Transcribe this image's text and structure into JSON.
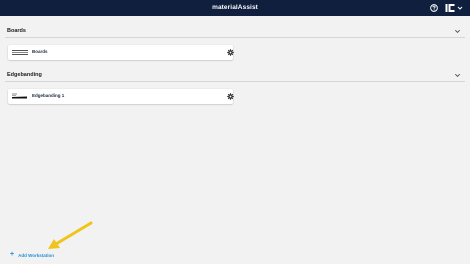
{
  "app": {
    "title": "materialAssist"
  },
  "colors": {
    "topbar": "#0f1f3d",
    "accent": "#1e8fd6",
    "background": "#f2f2f2",
    "annotation_arrow": "#f0c419"
  },
  "icons": {
    "help": "help-icon",
    "brand": "ihb-logo-icon",
    "account_menu": "chevron-down-icon",
    "collapse": "chevron-up-icon",
    "settings": "gear-icon",
    "add": "plus-icon"
  },
  "sections": [
    {
      "title": "Boards",
      "items": [
        {
          "name": "Boards",
          "thumbnail": "board-thumbnail"
        }
      ]
    },
    {
      "title": "Edgebanding",
      "items": [
        {
          "name": "Edgebanding 1",
          "thumbnail": "edgebanding-thumbnail"
        }
      ]
    }
  ],
  "footer": {
    "add_workstation_label": "Add Workstation"
  }
}
